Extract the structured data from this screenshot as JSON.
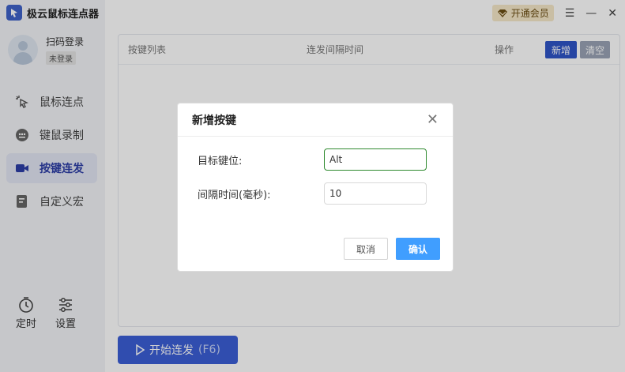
{
  "app": {
    "title": "极云鼠标连点器"
  },
  "user": {
    "login_label": "扫码登录",
    "status_badge": "未登录"
  },
  "sidebar": {
    "items": [
      {
        "label": "鼠标连点",
        "icon": "mouse-click-icon"
      },
      {
        "label": "键鼠录制",
        "icon": "record-icon"
      },
      {
        "label": "按键连发",
        "icon": "video-icon",
        "active": true
      },
      {
        "label": "自定义宏",
        "icon": "macro-icon"
      }
    ],
    "tools": [
      {
        "label": "定时",
        "icon": "timer-icon"
      },
      {
        "label": "设置",
        "icon": "settings-icon"
      }
    ]
  },
  "topbar": {
    "vip_label": "开通会员",
    "menu_icon": "☰",
    "minimize_icon": "—",
    "close_icon": "✕"
  },
  "table": {
    "columns": [
      "按键列表",
      "连发间隔时间",
      "操作"
    ],
    "add_label": "新增",
    "clear_label": "清空"
  },
  "start_button": {
    "label": "开始连发",
    "hotkey": "(F6)"
  },
  "modal": {
    "title": "新增按键",
    "close_icon": "✕",
    "fields": [
      {
        "label": "目标键位:",
        "value": "Alt"
      },
      {
        "label": "间隔时间(毫秒):",
        "value": "10"
      }
    ],
    "cancel_label": "取消",
    "confirm_label": "确认"
  },
  "colors": {
    "accent": "#2f55c7",
    "primary_button": "#409eff",
    "focus_border": "#2f8a2f",
    "overlay": "rgba(0,0,0,0.18)"
  }
}
